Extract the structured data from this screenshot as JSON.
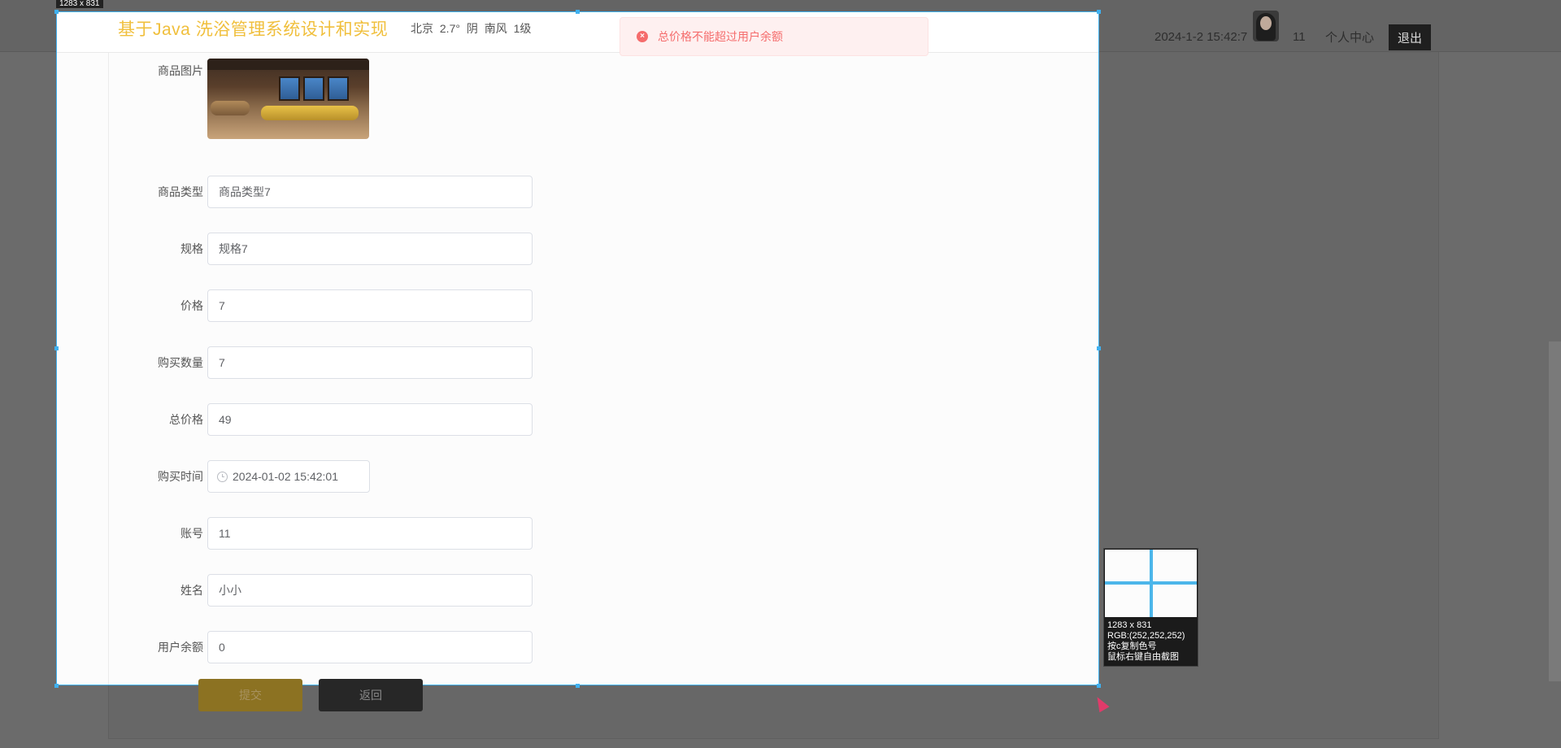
{
  "header": {
    "datetime": "2024-1-2 15:42:7",
    "user": "11",
    "center_label": "个人中心",
    "logout_label": "退出"
  },
  "frame": {
    "size_label": "1283 x 831",
    "site_title": "基于Java 洗浴管理系统设计和实现",
    "weather": "北京  2.7°  阴  南风  1级"
  },
  "toast": {
    "message": "总价格不能超过用户余额"
  },
  "form": {
    "image_label": "商品图片",
    "fields": [
      {
        "label": "商品类型",
        "value": "商品类型7"
      },
      {
        "label": "规格",
        "value": "规格7"
      },
      {
        "label": "价格",
        "value": "7"
      },
      {
        "label": "购买数量",
        "value": "7"
      },
      {
        "label": "总价格",
        "value": "49"
      },
      {
        "label": "购买时间",
        "value": "2024-01-02 15:42:01"
      },
      {
        "label": "账号",
        "value": "11"
      },
      {
        "label": "姓名",
        "value": "小小"
      },
      {
        "label": "用户余额",
        "value": "0"
      }
    ],
    "submit_label": "提交",
    "back_label": "返回"
  },
  "magnifier": {
    "size": "1283 x 831",
    "rgb": "RGB:(252,252,252)",
    "hint_copy": "按c复制色号",
    "hint_right": "鼠标右键自由截图"
  },
  "colors": {
    "title": "#f0bf3c",
    "error": "#f56c6c",
    "frame": "#3fb1f1"
  }
}
